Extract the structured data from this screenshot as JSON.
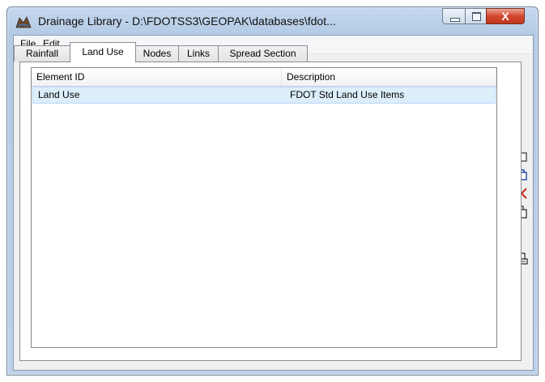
{
  "window": {
    "title": "Drainage Library - D:\\FDOTSS3\\GEOPAK\\databases\\fdot...",
    "close_glyph": "X"
  },
  "menu": {
    "items": [
      {
        "label": "File",
        "accel": "F",
        "rest": "ile"
      },
      {
        "label": "Edit",
        "accel": "E",
        "rest": "dit"
      }
    ]
  },
  "tabs": [
    {
      "label": "Rainfall"
    },
    {
      "label": "Land Use",
      "active": true
    },
    {
      "label": "Nodes"
    },
    {
      "label": "Links"
    },
    {
      "label": "Spread Section"
    }
  ],
  "list": {
    "columns": [
      "Element ID",
      "Description"
    ],
    "rows": [
      {
        "element_id": "Land Use",
        "description": "FDOT Std Land Use Items",
        "selected": true
      }
    ]
  },
  "tools": [
    {
      "name": "new-item",
      "glyph": "☐",
      "color": "#333333"
    },
    {
      "name": "copy-item",
      "glyph": "⧉",
      "color": "#1a3ea8"
    },
    {
      "name": "delete-item",
      "glyph": "✕",
      "color": "#c8281e"
    },
    {
      "name": "duplicate-item",
      "glyph": "⎘",
      "color": "#222222"
    },
    {
      "name": "print",
      "glyph": "🖨",
      "color": "#222222"
    }
  ]
}
